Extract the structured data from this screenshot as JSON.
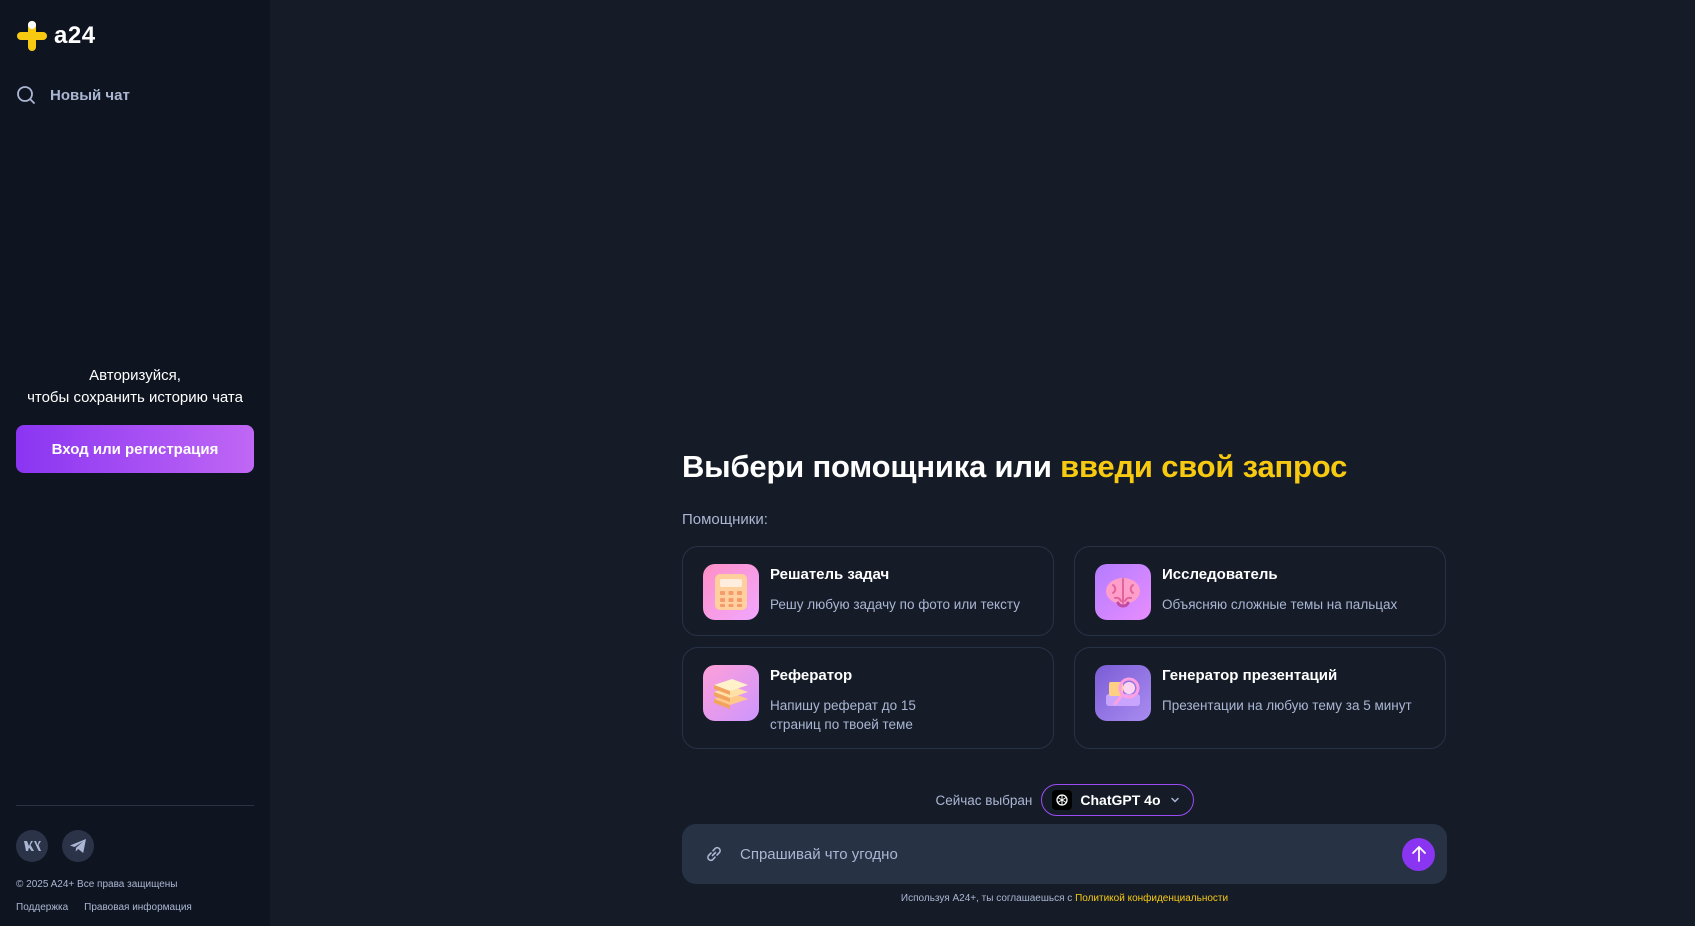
{
  "brand": {
    "logo_text": "a24",
    "accent": "#f7c911",
    "purple": "#8a35f2"
  },
  "sidebar": {
    "new_chat_label": "Новый чат",
    "auth_line1": "Авторизуйся,",
    "auth_line2": "чтобы сохранить историю чата",
    "login_label": "Вход или регистрация",
    "socials": [
      "vk-icon",
      "telegram-icon"
    ],
    "copyright": "© 2025 A24+ Все права защищены",
    "support_link": "Поддержка",
    "legal_link": "Правовая информация"
  },
  "main": {
    "headline_part1": "Выбери помощника или ",
    "headline_accent": "введи свой запрос",
    "helpers_label": "Помощники:",
    "helpers": [
      {
        "title": "Решатель задач",
        "desc": "Решу любую задачу по фото или тексту",
        "icon": "calculator-icon"
      },
      {
        "title": "Исследователь",
        "desc": "Объясняю сложные темы на пальцах",
        "icon": "brain-icon"
      },
      {
        "title": "Рефератор",
        "desc_line1": "Напишу реферат до 15",
        "desc_line2": "страниц по твоей теме",
        "icon": "books-icon"
      },
      {
        "title": "Генератор презентаций",
        "desc": "Презентации на любую тему за 5 минут",
        "icon": "presentation-icon"
      }
    ],
    "model_label": "Сейчас выбран",
    "model_name": "ChatGPT 4o",
    "input_placeholder": "Спрашивай что угодно",
    "disclaimer_text": "Используя A24+, ты соглашаешься с ",
    "disclaimer_link": "Политикой конфиденциальности"
  }
}
